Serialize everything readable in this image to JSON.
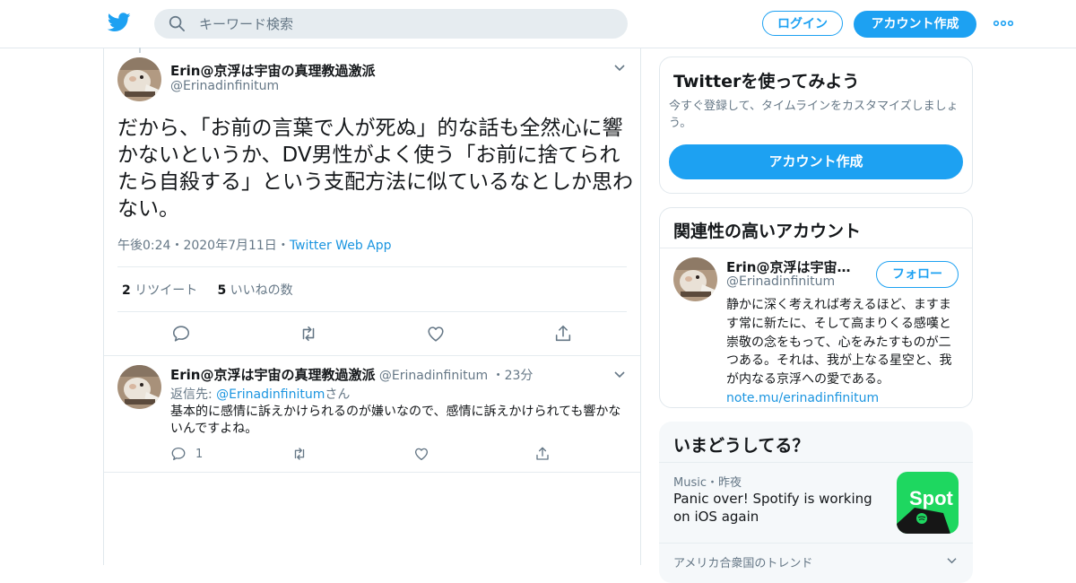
{
  "header": {
    "search_placeholder": "キーワード検索",
    "login_label": "ログイン",
    "signup_label": "アカウント作成"
  },
  "tweet": {
    "author_name": "Erin@京浮は宇宙の真理教過激派",
    "author_handle": "@Erinadinfinitum",
    "text": "だから、「お前の言葉で人が死ぬ」的な話も全然心に響かないというか、DV男性がよく使う「お前に捨てられたら自殺する」という支配方法に似ているなとしか思わない。",
    "time": "午後0:24",
    "date": "2020年7月11日",
    "source": "Twitter Web App",
    "retweet_count": "2",
    "retweet_label": "リツイート",
    "like_count": "5",
    "like_label": "いいねの数"
  },
  "reply": {
    "author_name": "Erin@京浮は宇宙の真理教過激派",
    "author_handle": "@Erinadinfinitum",
    "age": "23分",
    "reply_to_prefix": "返信先: ",
    "reply_to_handle": "@Erinadinfinitum",
    "reply_to_suffix": "さん",
    "text": "基本的に感情に訴えかけられるのが嫌いなので、感情に訴えかけられても響かないんですよね。",
    "reply_count": "1"
  },
  "sidebar": {
    "join": {
      "title": "Twitterを使ってみよう",
      "description": "今すぐ登録して、タイムラインをカスタマイズしましょう。",
      "button": "アカウント作成"
    },
    "related": {
      "title": "関連性の高いアカウント",
      "name": "Erin@京浮は宇宙の真理教過激派",
      "handle": "@Erinadinfinitum",
      "follow_label": "フォロー",
      "bio": "静かに深く考えれば考えるほど、ますます常に新たに、そして高まりくる感嘆と崇敬の念をもって、心をみたすものが二つある。それは、我が上なる星空と、我が内なる京浮への愛である。",
      "bio_link": "note.mu/erinadinfinitum"
    },
    "trends": {
      "title": "いまどうしてる？",
      "item1_category": "Music",
      "item1_age": "昨夜",
      "item1_title": "Panic over! Spotify is working on iOS again",
      "item1_image_text": "Spot",
      "item2_category": "アメリカ合衆国のトレンド"
    }
  },
  "colors": {
    "brand_blue": "#1da1f2",
    "link_blue": "#1b95e0",
    "secondary_text": "#657786",
    "spotify_green": "#1ed760"
  }
}
